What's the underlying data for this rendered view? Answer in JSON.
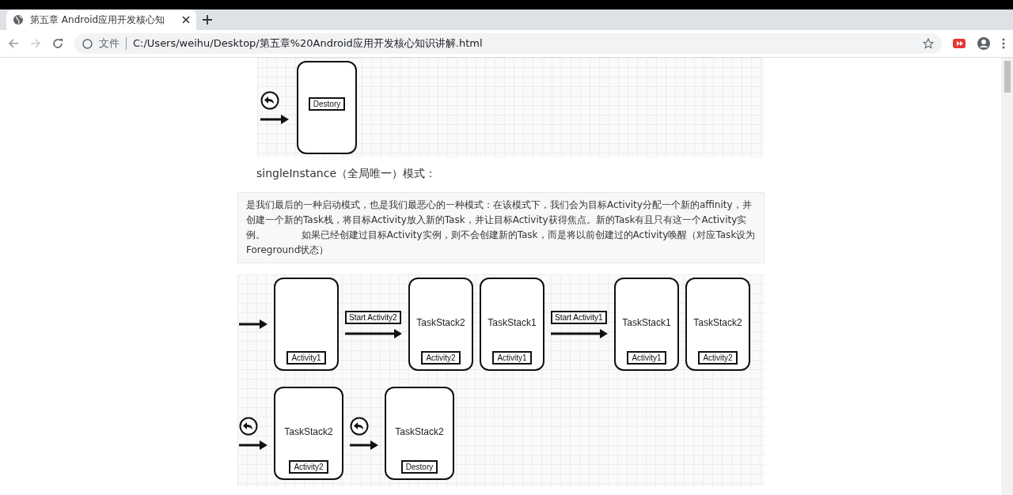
{
  "tab": {
    "title": "第五章 Android应用开发核心知",
    "selected": true
  },
  "address_bar": {
    "scheme_label": "文件",
    "url": "C:/Users/weihu/Desktop/第五章%20Android应用开发核心知识讲解.html"
  },
  "diagram_top": {
    "steps": [
      {
        "kind": "back-arrow"
      },
      {
        "kind": "stack",
        "label": "Destory"
      }
    ]
  },
  "heading": "singleInstance（全局唯一）模式：",
  "quote": "是我们最后的一种启动模式，也是我们最恶心的一种模式：在该模式下，我们会为目标Activity分配一个新的affinity，并创建一个新的Task栈，将目标Activity放入新的Task，并让目标Activity获得焦点。新的Task有且只有这一个Activity实例。            如果已经创建过目标Activity实例，则不会创建新的Task，而是将以前创建过的Activity唤醒（对应Task设为Foreground状态）",
  "diagram_bottom": {
    "rows": [
      [
        {
          "kind": "arrow"
        },
        {
          "kind": "stack",
          "label": "Activity1"
        },
        {
          "kind": "arrow",
          "caption": "Start Activity2"
        },
        {
          "kind": "stack",
          "title": "TaskStack2",
          "label": "Activity2"
        },
        {
          "kind": "stack",
          "title": "TaskStack1",
          "label": "Activity1"
        },
        {
          "kind": "arrow",
          "caption": "Start Activity1"
        },
        {
          "kind": "stack",
          "title": "TaskStack1",
          "label": "Activity1"
        },
        {
          "kind": "stack",
          "title": "TaskStack2",
          "label": "Activity2"
        }
      ],
      [
        {
          "kind": "back-arrow"
        },
        {
          "kind": "stack",
          "title": "TaskStack2",
          "label": "Activity2"
        },
        {
          "kind": "back-arrow"
        },
        {
          "kind": "stack",
          "title": "TaskStack2",
          "label": "Destory"
        }
      ]
    ]
  }
}
